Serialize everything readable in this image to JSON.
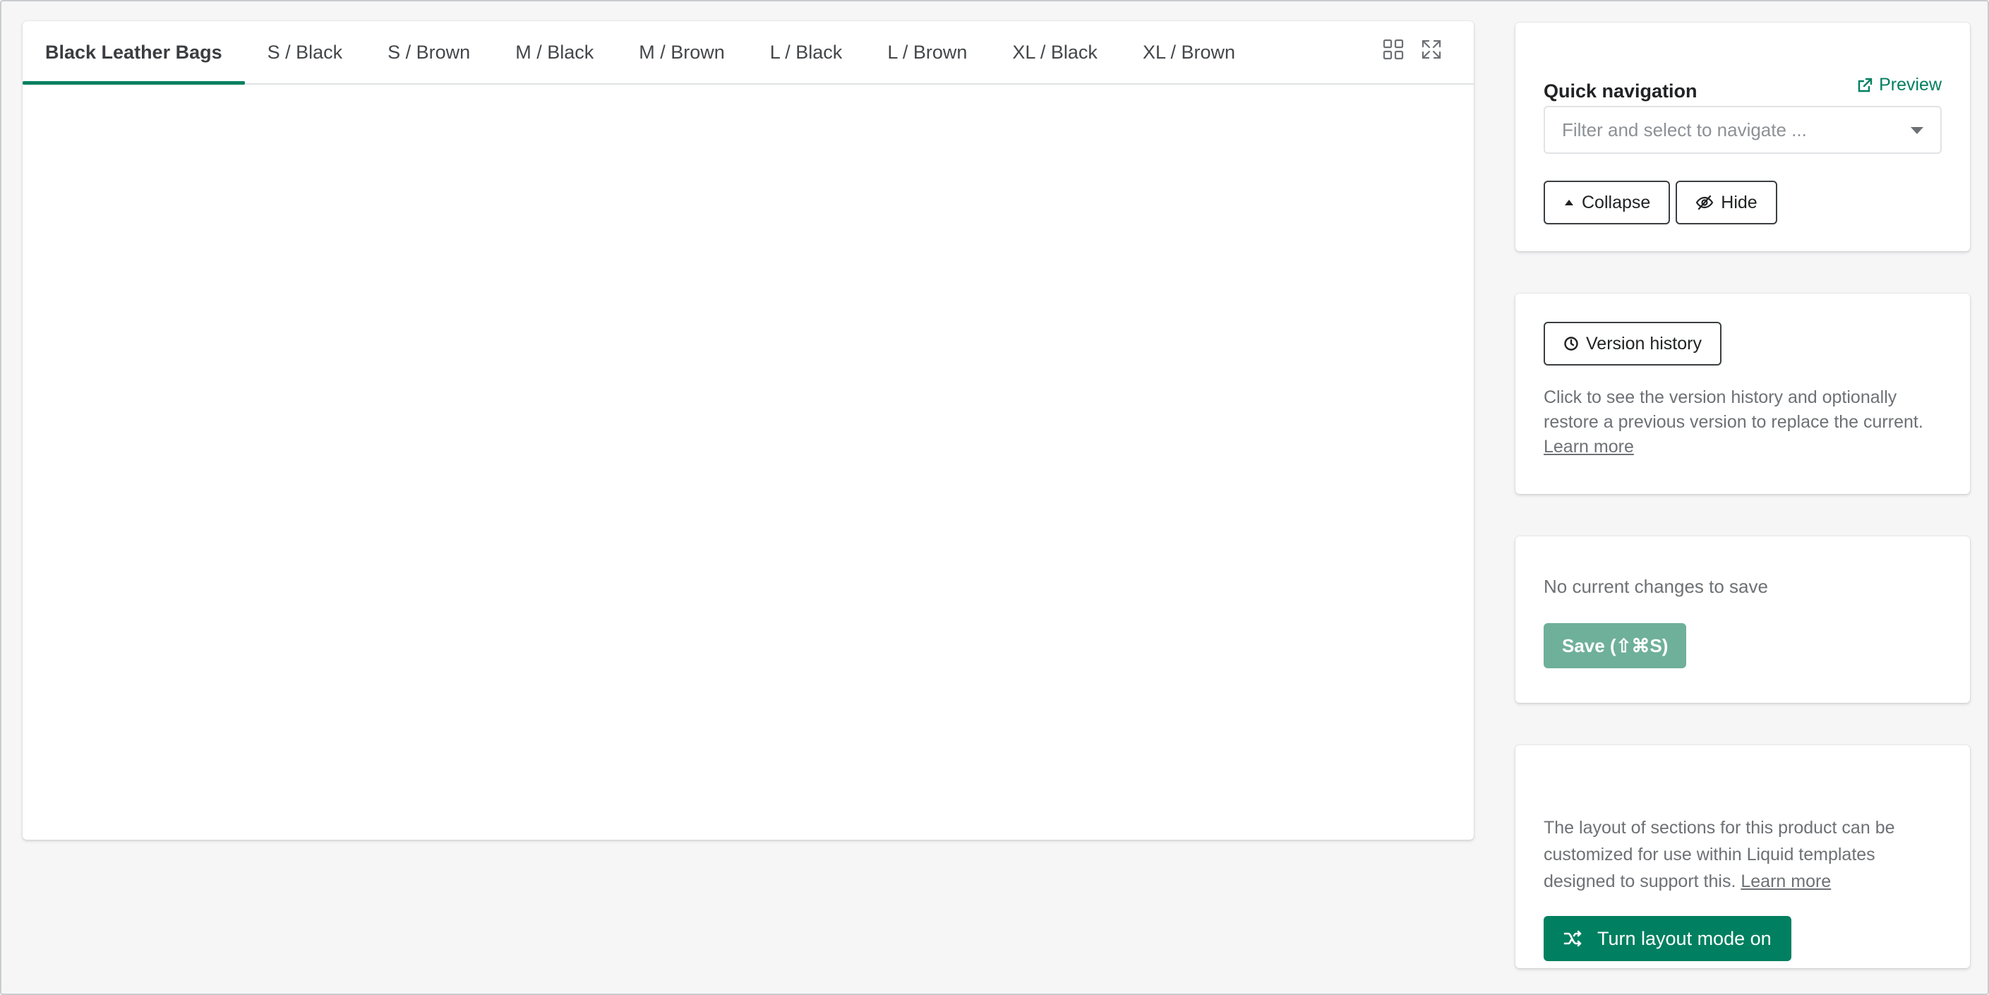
{
  "tabs": [
    {
      "label": "Black Leather Bags",
      "active": true
    },
    {
      "label": "S / Black"
    },
    {
      "label": "S / Brown"
    },
    {
      "label": "M / Black"
    },
    {
      "label": "M / Brown"
    },
    {
      "label": "L / Black"
    },
    {
      "label": "L / Brown"
    },
    {
      "label": "XL / Black"
    },
    {
      "label": "XL / Brown"
    }
  ],
  "tab_icons": [
    "grid-view-icon",
    "expand-icon"
  ],
  "quick_nav": {
    "title": "Quick navigation",
    "preview_label": "Preview",
    "filter_placeholder": "Filter and select to navigate ...",
    "collapse_label": "Collapse",
    "hide_label": "Hide"
  },
  "version": {
    "button_label": "Version history",
    "description": "Click to see the version history and optionally restore a previous version to replace the current.",
    "learn_more": "Learn more"
  },
  "save": {
    "status": "No current changes to save",
    "button_label": "Save (⇧⌘S)"
  },
  "layout": {
    "description": "The layout of sections for this product can be customized for use within Liquid templates designed to support this.",
    "learn_more": "Learn more",
    "button_label": "Turn layout mode on"
  },
  "colors": {
    "accent": "#008060",
    "save_disabled": "#6fb09a",
    "link": "#007f5f"
  }
}
